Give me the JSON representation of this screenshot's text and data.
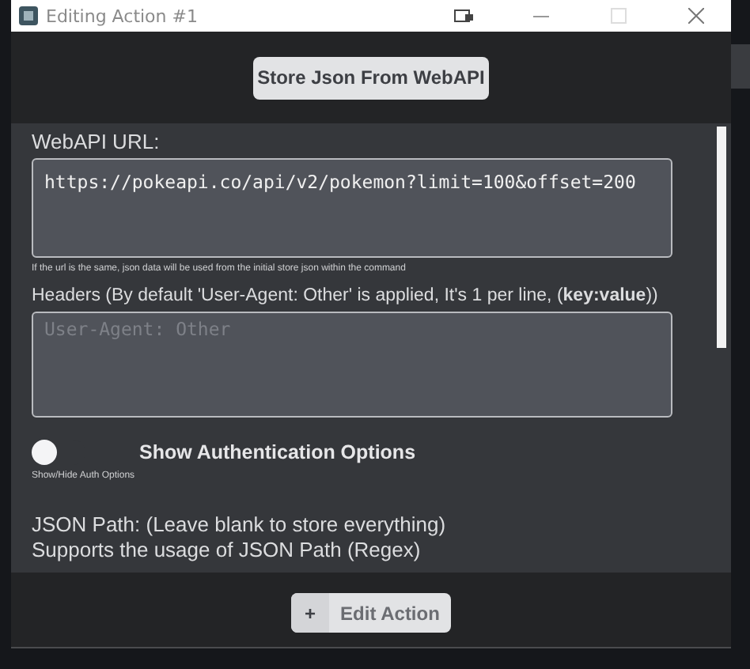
{
  "window": {
    "title": "Editing Action #1"
  },
  "top_button": {
    "label": "Store Json From WebAPI"
  },
  "url_field": {
    "label": "WebAPI URL:",
    "value": "https://pokeapi.co/api/v2/pokemon?limit=100&offset=200",
    "hint": "If the url is the same, json data will be used from the initial store json within the command"
  },
  "headers_field": {
    "label": "Headers (By default 'User-Agent: Other' is applied, It's 1 per line, (**key:value**))",
    "placeholder": "User-Agent: Other"
  },
  "auth_toggle": {
    "label": "Show Authentication Options",
    "on": false,
    "hint": "Show/Hide Auth Options"
  },
  "json_path": {
    "lines": [
      "JSON Path: (Leave blank to store everything)",
      "Supports the usage of JSON Path (Regex)"
    ]
  },
  "footer_button": {
    "icon": "+",
    "label": "Edit Action"
  }
}
